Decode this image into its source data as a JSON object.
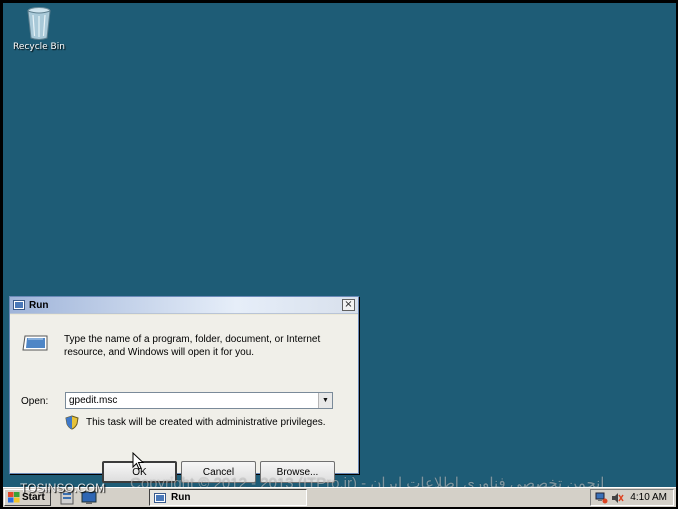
{
  "desktop": {
    "icons": [
      {
        "label": "Recycle Bin",
        "icon": "recycle-bin-icon"
      }
    ]
  },
  "run_dialog": {
    "title": "Run",
    "description": "Type the name of a program, folder, document, or Internet resource, and Windows will open it for you.",
    "open_label": "Open:",
    "open_value": "gpedit.msc",
    "admin_note": "This task will be created with administrative privileges.",
    "ok_label": "OK",
    "cancel_label": "Cancel",
    "browse_label": "Browse...",
    "close_glyph": "×"
  },
  "taskbar": {
    "start_label": "Start",
    "tasks": [
      {
        "label": "Run"
      }
    ],
    "clock": "4:10 AM"
  },
  "watermarks": {
    "site": "TOSINSO.COM",
    "copyright": "Copyright © 2012 - 2013 (ITPro.ir) - انجمن تخصصی فناوری اطلاعات ایران"
  },
  "colors": {
    "desktop_bg": "#1e5c76",
    "dialog_bg": "#f0efe9",
    "taskbar_bg": "#d4d0c8"
  }
}
